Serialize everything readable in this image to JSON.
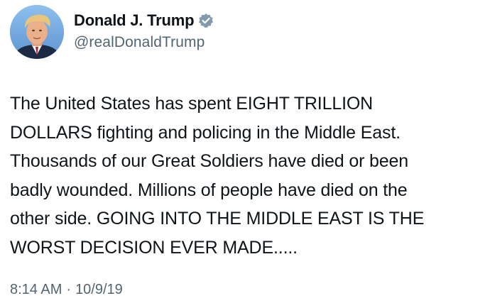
{
  "author": {
    "display_name": "Donald J. Trump",
    "handle": "@realDonaldTrump",
    "avatar_icon": "profile-photo",
    "verified_icon": "verified-badge-icon",
    "verified_color": "#829aab"
  },
  "tweet": {
    "text": "The United States has spent EIGHT TRILLION\nDOLLARS fighting and policing in the Middle East.\nThousands of our Great Soldiers have died or been\nbadly wounded. Millions of people have died on the\nother side. GOING INTO THE MIDDLE EAST IS THE\nWORST DECISION EVER MADE....."
  },
  "meta": {
    "time": "8:14 AM",
    "separator": "·",
    "date": "10/9/19"
  }
}
